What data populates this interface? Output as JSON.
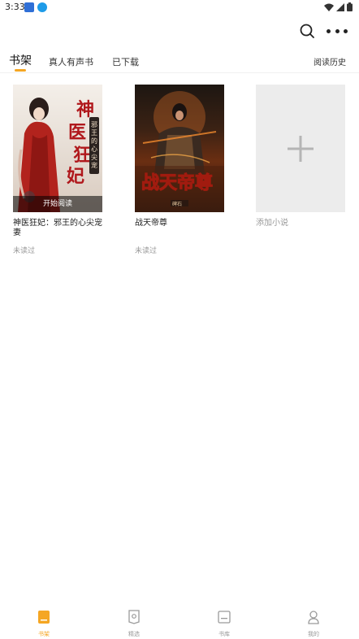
{
  "status": {
    "time": "3:33"
  },
  "tabs": [
    {
      "label": "书架",
      "active": true
    },
    {
      "label": "真人有声书",
      "active": false
    },
    {
      "label": "已下载",
      "active": false
    }
  ],
  "history_label": "阅读历史",
  "books": [
    {
      "title": "神医狂妃：邪王的心尖宠妻",
      "status": "未读过",
      "cover_text": "神医狂妃",
      "cover_sub": "邪王的心尖宠妻",
      "badge": "开始阅读"
    },
    {
      "title": "战天帝尊",
      "status": "未读过",
      "cover_text": "战天帝尊",
      "cover_author": "碑石"
    }
  ],
  "add_book_label": "添加小说",
  "nav": [
    {
      "label": "书架",
      "icon": "bookshelf-icon",
      "active": true
    },
    {
      "label": "精选",
      "icon": "featured-icon",
      "active": false
    },
    {
      "label": "书库",
      "icon": "library-icon",
      "active": false
    },
    {
      "label": "我的",
      "icon": "profile-icon",
      "active": false
    }
  ],
  "colors": {
    "accent": "#f5a623",
    "muted": "#999999",
    "placeholder": "#ececec"
  }
}
